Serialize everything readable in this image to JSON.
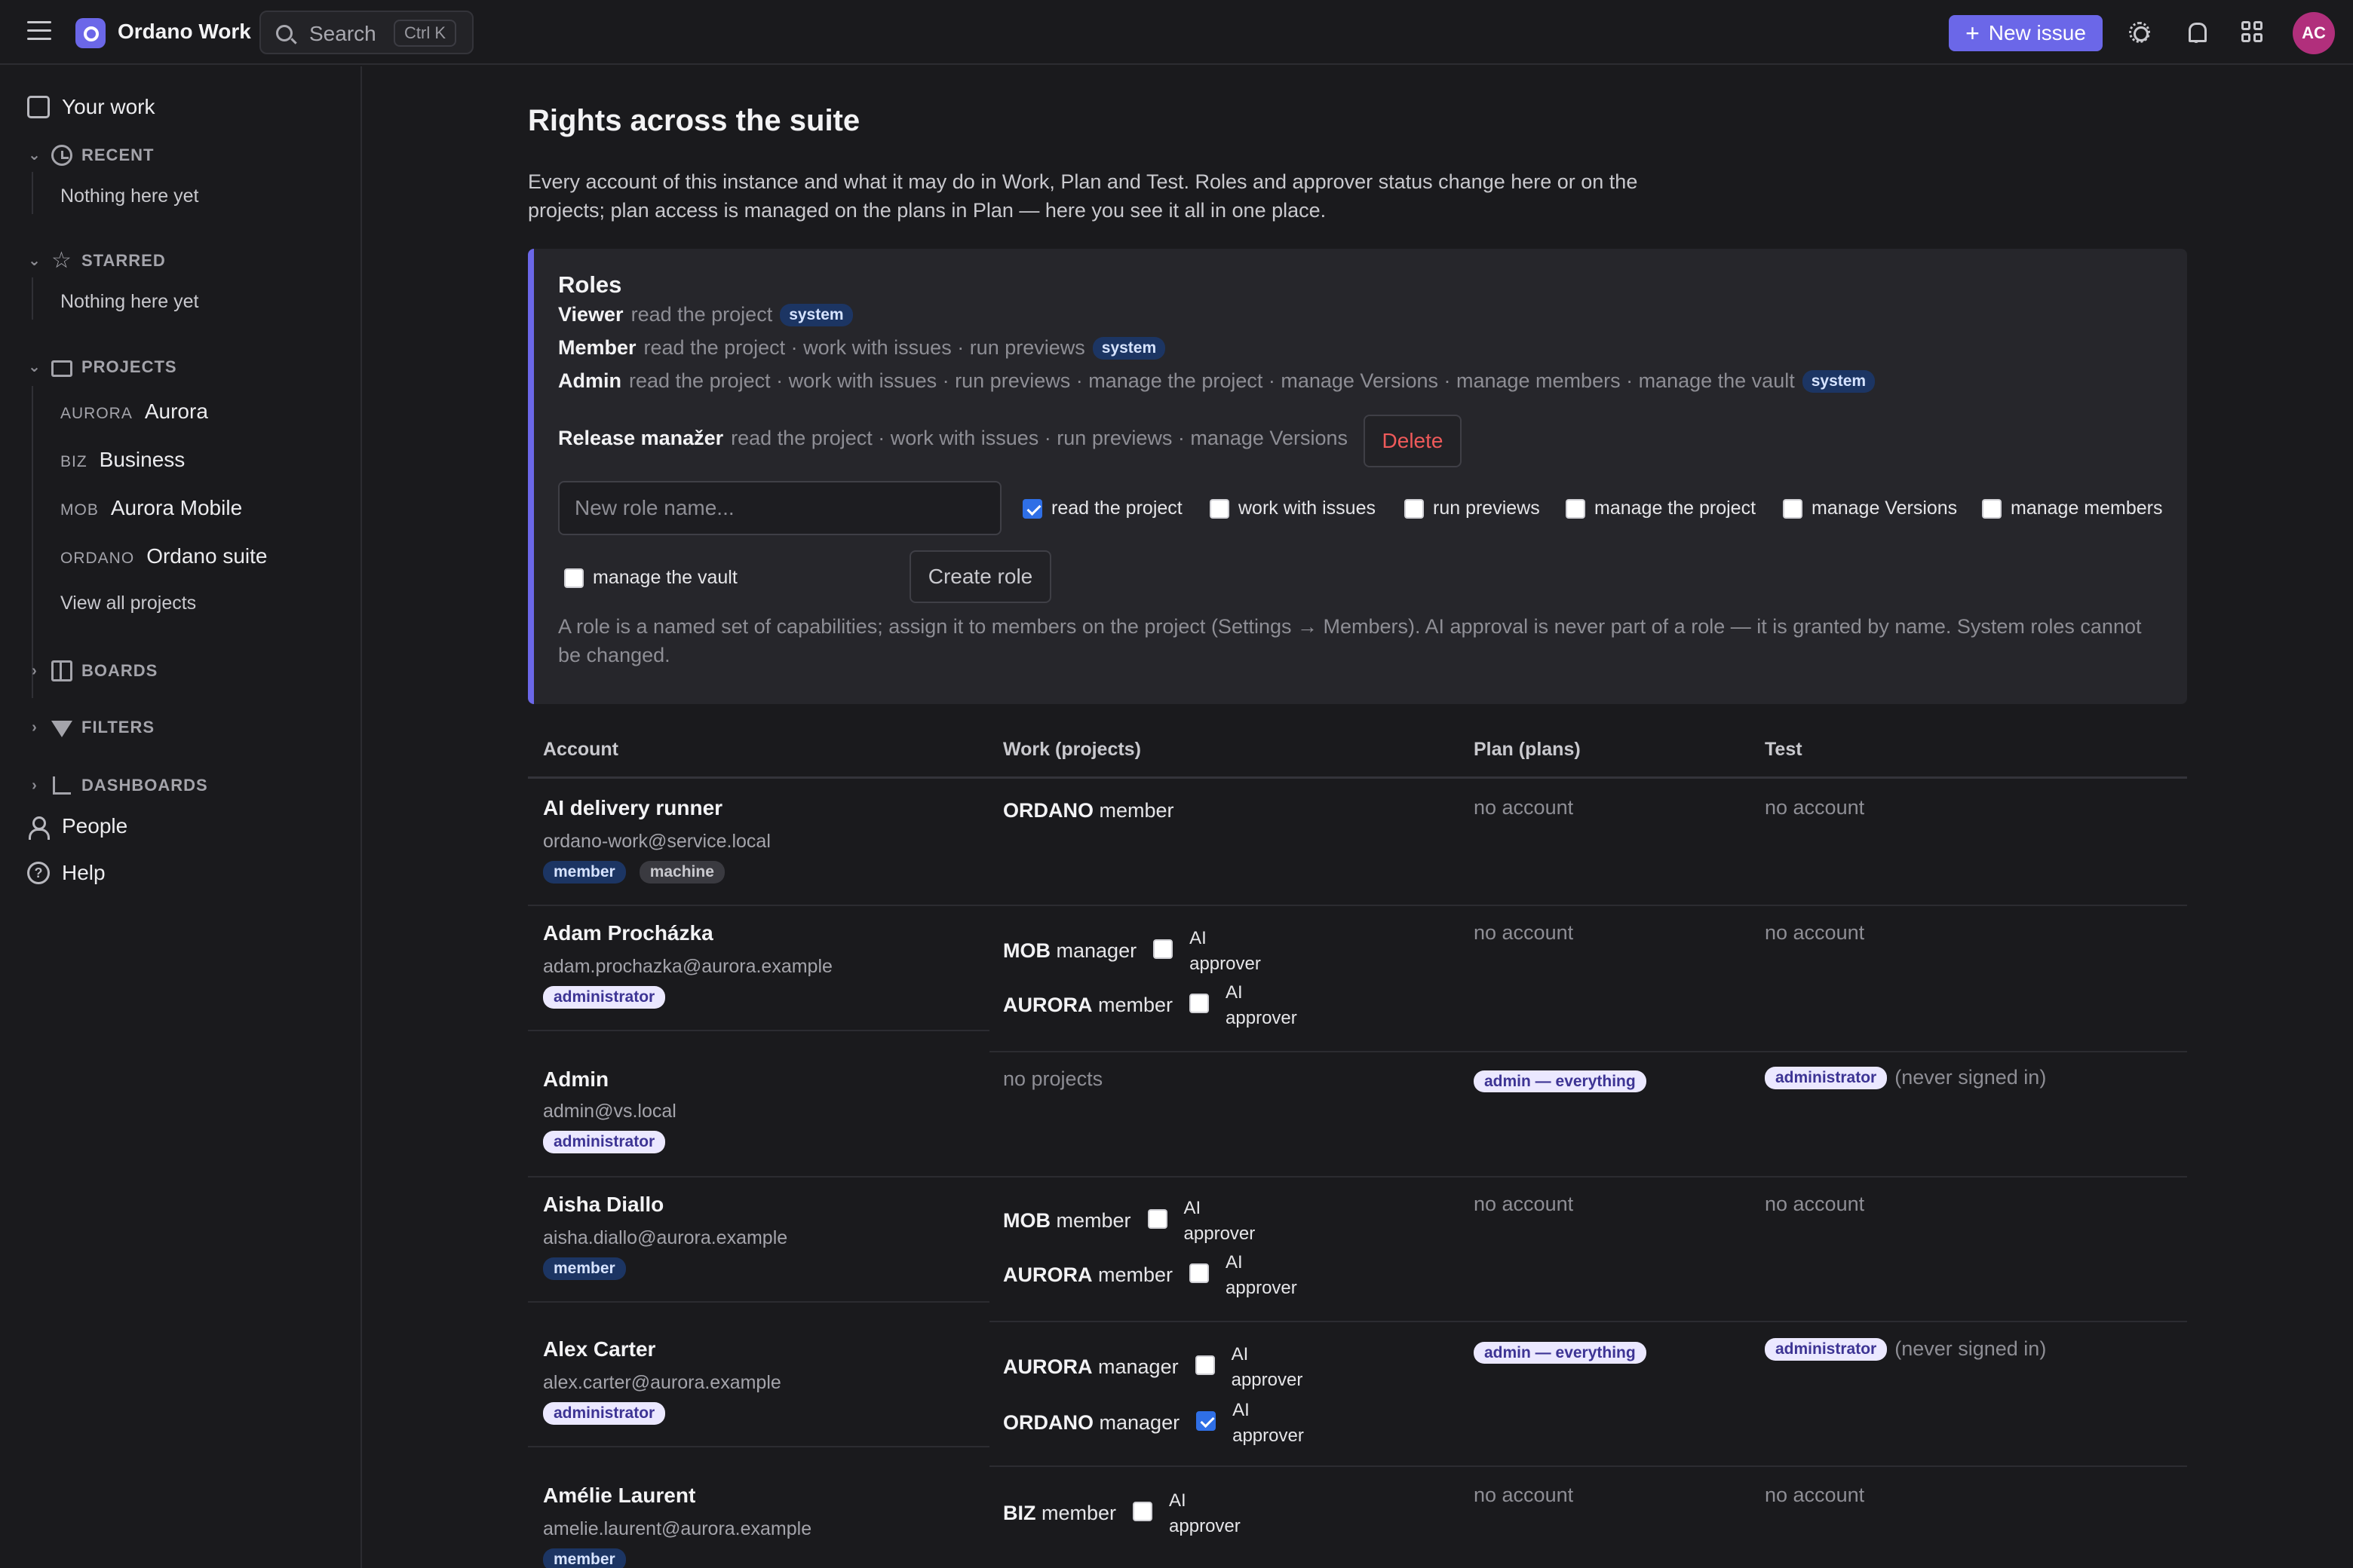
{
  "topbar": {
    "app_title": "Ordano Work",
    "search_label": "Search",
    "search_shortcut": "Ctrl K",
    "new_issue_label": "New issue",
    "new_issue_icon": "+",
    "avatar_initials": "AC",
    "colors": {
      "accent": "#6b67e8",
      "avatar": "#b12f7c"
    }
  },
  "sidebar": {
    "your_work": "Your work",
    "recent": {
      "label": "RECENT",
      "empty": "Nothing here yet"
    },
    "starred": {
      "label": "STARRED",
      "empty": "Nothing here yet"
    },
    "projects": {
      "label": "PROJECTS",
      "items": [
        {
          "key": "AURORA",
          "name": "Aurora"
        },
        {
          "key": "BIZ",
          "name": "Business"
        },
        {
          "key": "MOB",
          "name": "Aurora Mobile"
        },
        {
          "key": "ORDANO",
          "name": "Ordano suite"
        }
      ],
      "view_all": "View all projects"
    },
    "boards": "BOARDS",
    "filters": "FILTERS",
    "dashboards": "DASHBOARDS",
    "people": "People",
    "help": "Help"
  },
  "page": {
    "title": "Rights across the suite",
    "intro": "Every account of this instance and what it may do in Work, Plan and Test. Roles and approver status change here or on the projects; plan access is managed on the plans in Plan — here you see it all in one place."
  },
  "roles": {
    "title": "Roles",
    "list": [
      {
        "name": "Viewer",
        "caps": "read the project",
        "badge": "system"
      },
      {
        "name": "Member",
        "caps": "read the project · work with issues · run previews",
        "badge": "system"
      },
      {
        "name": "Admin",
        "caps": "read the project · work with issues · run previews · manage the project · manage Versions · manage members · manage the vault",
        "badge": "system"
      },
      {
        "name": "Release manažer",
        "caps": "read the project · work with issues · run previews · manage Versions",
        "badge": ""
      }
    ],
    "delete_label": "Delete",
    "new_role_placeholder": "New role name...",
    "capabilities": [
      {
        "label": "read the project",
        "checked": true
      },
      {
        "label": "work with issues",
        "checked": false
      },
      {
        "label": "run previews",
        "checked": false
      },
      {
        "label": "manage the project",
        "checked": false
      },
      {
        "label": "manage Versions",
        "checked": false
      },
      {
        "label": "manage members",
        "checked": false
      },
      {
        "label": "manage the vault",
        "checked": false
      }
    ],
    "create_label": "Create role",
    "note": "A role is a named set of capabilities; assign it to members on the project (Settings → Members). AI approval is never part of a role — it is granted by name. System roles cannot be changed."
  },
  "table": {
    "headers": {
      "account": "Account",
      "work": "Work (projects)",
      "plan": "Plan (plans)",
      "test": "Test"
    },
    "ai_label_1": "AI",
    "ai_label_2": "approver",
    "rows": [
      {
        "name": "AI delivery runner",
        "email": "ordano-work@service.local",
        "badges": [
          "member",
          "machine"
        ],
        "work": [
          {
            "key": "ORDANO",
            "role": "member",
            "ai": null
          }
        ],
        "plan": "no account",
        "test": "no account",
        "test_note": ""
      },
      {
        "name": "Adam Procházka",
        "email": "adam.prochazka@aurora.example",
        "badges": [
          "administrator"
        ],
        "work": [
          {
            "key": "MOB",
            "role": "manager",
            "ai": false
          },
          {
            "key": "AURORA",
            "role": "member",
            "ai": false
          }
        ],
        "plan": "no account",
        "test": "no account",
        "test_note": ""
      },
      {
        "name": "Admin",
        "email": "admin@vs.local",
        "badges": [
          "administrator"
        ],
        "work_empty": "no projects",
        "plan_badge": "admin — everything",
        "test_badge": "administrator",
        "test_note": "(never signed in)"
      },
      {
        "name": "Aisha Diallo",
        "email": "aisha.diallo@aurora.example",
        "badges": [
          "member"
        ],
        "work": [
          {
            "key": "MOB",
            "role": "member",
            "ai": false
          },
          {
            "key": "AURORA",
            "role": "member",
            "ai": false
          }
        ],
        "plan": "no account",
        "test": "no account"
      },
      {
        "name": "Alex Carter",
        "email": "alex.carter@aurora.example",
        "badges": [
          "administrator"
        ],
        "work": [
          {
            "key": "AURORA",
            "role": "manager",
            "ai": false
          },
          {
            "key": "ORDANO",
            "role": "manager",
            "ai": true
          }
        ],
        "plan_badge": "admin — everything",
        "test_badge": "administrator",
        "test_note": "(never signed in)"
      },
      {
        "name": "Amélie Laurent",
        "email": "amelie.laurent@aurora.example",
        "badges": [
          "member"
        ],
        "work": [
          {
            "key": "BIZ",
            "role": "member",
            "ai": false
          }
        ],
        "plan": "no account",
        "test": "no account"
      }
    ]
  }
}
